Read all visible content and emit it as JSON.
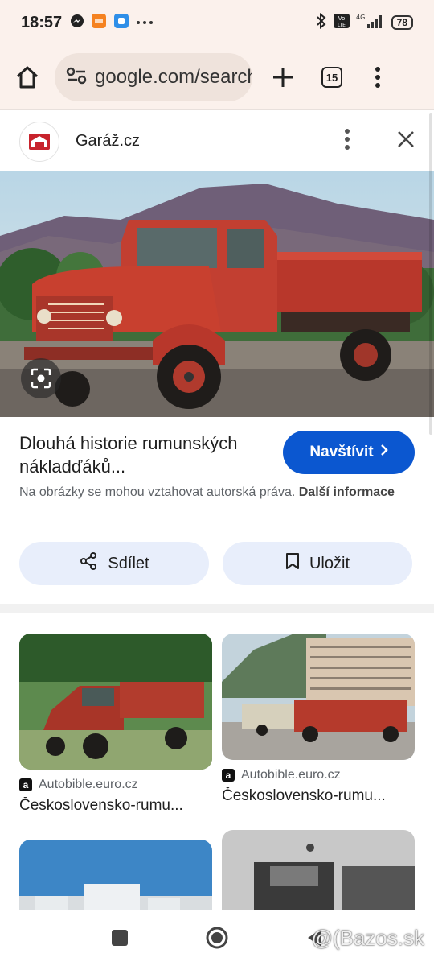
{
  "status_bar": {
    "time": "18:57",
    "network": "4G",
    "volte": "Vo LTE",
    "battery": "78"
  },
  "browser": {
    "url": "google.com/search",
    "tab_count": "15"
  },
  "site": {
    "name": "Garáž.cz"
  },
  "result": {
    "title": "Dlouhá historie rumunských nákladďáků...",
    "visit_label": "Navštívit",
    "copyright_text": "Na obrázky se mohou vztahovat autorská práva.",
    "copyright_link": "Další informace",
    "share_label": "Sdílet",
    "save_label": "Uložit"
  },
  "related": [
    {
      "source": "Autobible.euro.cz",
      "title": "Československo-rumu..."
    },
    {
      "source": "Autobible.euro.cz",
      "title": "Československo-rumu..."
    }
  ],
  "watermark": "@(Bazos.sk",
  "colors": {
    "accent": "#0b57d0",
    "chip_bg": "#e8eefb",
    "toolbar_bg": "#fbf1ec"
  }
}
